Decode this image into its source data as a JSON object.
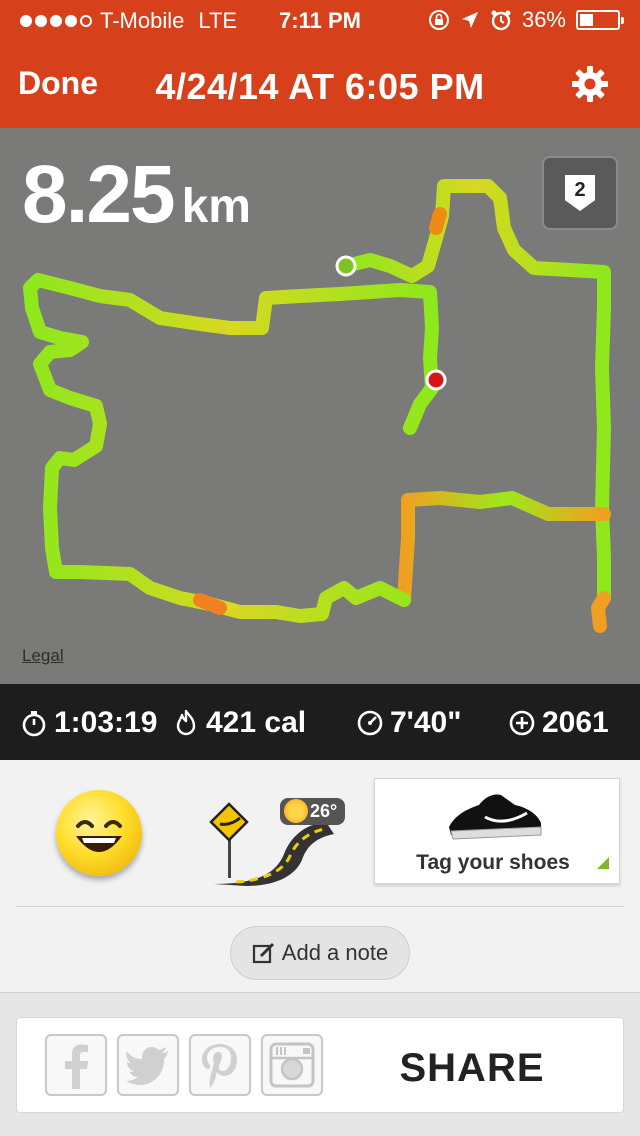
{
  "status_bar": {
    "carrier": "T-Mobile",
    "network": "LTE",
    "time": "7:11 PM",
    "battery": "36%",
    "battery_level": 0.36
  },
  "nav": {
    "done_label": "Done",
    "title": "4/24/14 AT 6:05 PM"
  },
  "run": {
    "distance": "8.25",
    "distance_unit": "km",
    "badge": "2",
    "legal": "Legal"
  },
  "stats": {
    "duration": "1:03:19",
    "calories": "421 cal",
    "pace": "7'40\"",
    "fuel": "2061"
  },
  "panel": {
    "temperature": "26°",
    "tag_shoes": "Tag your shoes",
    "add_note": "Add a note"
  },
  "share": {
    "label": "SHARE",
    "networks": [
      "facebook-icon",
      "twitter-icon",
      "pinterest-icon",
      "instagram-icon"
    ]
  },
  "colors": {
    "header": "#d6401b",
    "map": "#7a7a78",
    "stats_bar": "#1d1d1d",
    "route_fast": "#8ee81c",
    "route_slow": "#f0a020"
  }
}
